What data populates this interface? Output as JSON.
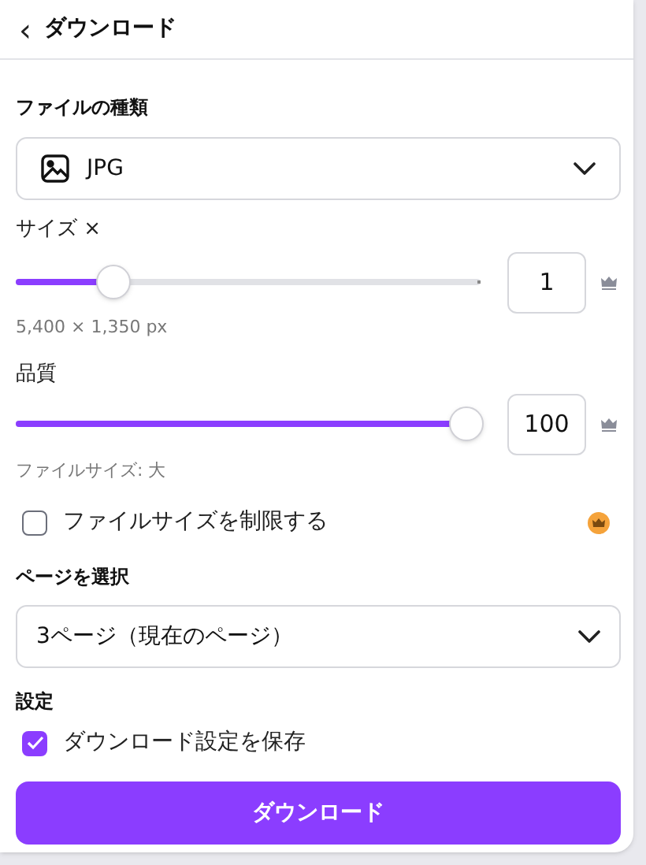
{
  "header": {
    "back_icon": "‹",
    "title": "ダウンロード"
  },
  "file_type": {
    "label": "ファイルの種類",
    "value": "JPG"
  },
  "size": {
    "label": "サイズ ×",
    "level": 0.21,
    "value": "1",
    "dimensions": "5,400 × 1,350 px"
  },
  "quality": {
    "label": "品質",
    "level": 0.97,
    "value": "100",
    "note": "ファイルサイズ: 大"
  },
  "limit_file_size": {
    "label": "ファイルサイズを制限する",
    "checked": false
  },
  "pages": {
    "label": "ページを選択",
    "value": "3ページ（現在のページ）"
  },
  "settings": {
    "label": "設定",
    "save": {
      "label": "ダウンロード設定を保存",
      "checked": true
    }
  },
  "download_button": "ダウンロード"
}
